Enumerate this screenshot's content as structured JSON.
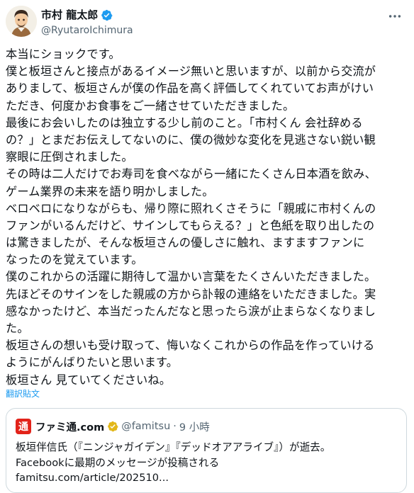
{
  "author": {
    "display_name": "市村 龍太郎",
    "handle": "@RyutaroIchimura"
  },
  "post": {
    "lines": [
      "本当にショックです。",
      "僕と板垣さんと接点があるイメージ無いと思いますが、以前から交流が",
      "ありまして、板垣さんが僕の作品を高く評価してくれていてお声がけい",
      "ただき、何度かお食事をご一緒させていただきました。",
      "最後にお会いしたのは独立する少し前のこと。「市村くん 会社辞める",
      "の？」とまだお伝えしてないのに、僕の微妙な変化を見逃さない鋭い観",
      "察眼に圧倒されました。",
      "その時は二人だけでお寿司を食べながら一緒にたくさん日本酒を飲み、",
      "ゲーム業界の未来を語り明かしました。",
      "ベロベロになりながらも、帰り際に照れくさそうに「親戚に市村くんの",
      "ファンがいるんだけど、サインしてもらえる？」と色紙を取り出したの",
      "は驚きましたが、そんな板垣さんの優しさに触れ、ますますファンに",
      "なったのを覚えています。",
      "僕のこれからの活躍に期待して温かい言葉をたくさんいただきました。",
      "先ほどそのサインをした親戚の方から訃報の連絡をいただきました。実",
      "感なかったけど、本当だったんだなと思ったら涙が止まらなくなりまし",
      "た。",
      "板垣さんの想いも受け取って、悔いなくこれからの作品を作っていける",
      "ようにがんばりたいと思います。",
      "板垣さん 見ていてくださいね。"
    ],
    "translate_label": "翻訳貼文"
  },
  "quote": {
    "logo_text": "通",
    "name": "ファミ通.com",
    "handle": "@famitsu",
    "separator": "·",
    "time": "9 小時",
    "lines": [
      "板垣伴信氏（『ニンジャガイデン』『デッドオアアライブ』）が逝去。",
      "Facebookに最期のメッセージが投稿される",
      "famitsu.com/article/202510..."
    ]
  },
  "colors": {
    "verified_blue": "#1d9bf0",
    "verified_gold": "#e2b719",
    "famitsu_red": "#e2231a",
    "text_primary": "#0f1419",
    "text_secondary": "#536471"
  },
  "icons": {
    "verified": "verified-badge-icon",
    "more": "more-options-icon",
    "avatar": "avatar-image"
  }
}
